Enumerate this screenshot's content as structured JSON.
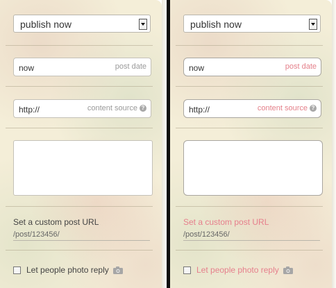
{
  "publish_select": {
    "value": "publish now"
  },
  "post_date": {
    "value": "now",
    "hint": "post date"
  },
  "content_source": {
    "value": "http://",
    "hint": "content source",
    "help_glyph": "?"
  },
  "custom_url": {
    "label": "Set a custom post URL",
    "slug": "/post/123456/"
  },
  "photo_reply": {
    "label": "Let people photo reply"
  },
  "colors": {
    "hint_gray": "#9a9a9a",
    "hint_pink": "#e4808a",
    "label_pink": "#e67f8c"
  }
}
